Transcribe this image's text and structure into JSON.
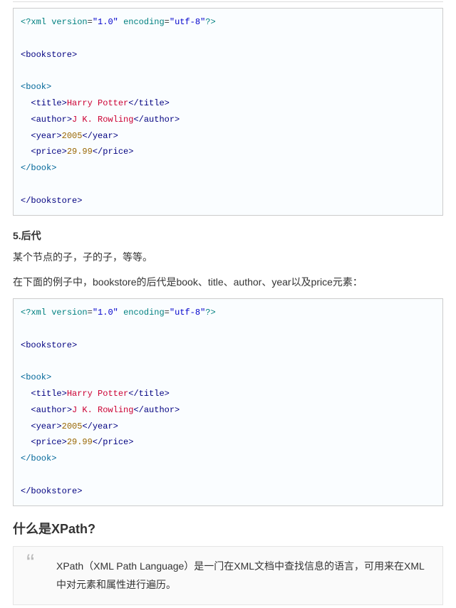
{
  "code1": {
    "decl_open": "<?",
    "decl_name": "xml",
    "decl_attr1_name": "version",
    "decl_attr1_val": "\"1.0\"",
    "decl_attr2_name": "encoding",
    "decl_attr2_val": "\"utf-8\"",
    "decl_close": "?>",
    "bookstore_open": "<bookstore>",
    "bookstore_close": "</bookstore>",
    "book_open": "<book>",
    "book_close": "</book>",
    "title_open": "<title>",
    "title_text": "Harry Potter",
    "title_close": "</title>",
    "author_open": "<author>",
    "author_text": "J K. Rowling",
    "author_close": "</author>",
    "year_open": "<year>",
    "year_text": "2005",
    "year_close": "</year>",
    "price_open": "<price>",
    "price_text": "29.99",
    "price_close": "</price>"
  },
  "section5": {
    "heading": "5.后代",
    "p1": "某个节点的子，子的子，等等。",
    "p2": "在下面的例子中，bookstore的后代是book、title、author、year以及price元素："
  },
  "code2": {
    "decl_open": "<?",
    "decl_name": "xml",
    "decl_attr1_name": "version",
    "decl_attr1_val": "\"1.0\"",
    "decl_attr2_name": "encoding",
    "decl_attr2_val": "\"utf-8\"",
    "decl_close": "?>",
    "bookstore_open": "<bookstore>",
    "bookstore_close": "</bookstore>",
    "book_open": "<book>",
    "book_close": "</book>",
    "title_open": "<title>",
    "title_text": "Harry Potter",
    "title_close": "</title>",
    "author_open": "<author>",
    "author_text": "J K. Rowling",
    "author_close": "</author>",
    "year_open": "<year>",
    "year_text": "2005",
    "year_close": "</year>",
    "price_open": "<price>",
    "price_text": "29.99",
    "price_close": "</price>"
  },
  "xpath": {
    "heading": "什么是XPath?",
    "quote": "XPath（XML Path Language）是一门在XML文档中查找信息的语言，可用来在XML中对元素和属性进行遍历。"
  },
  "glyphs": {
    "eq": "=",
    "sp": " ",
    "indent": "  ",
    "quote_mark": "“"
  }
}
